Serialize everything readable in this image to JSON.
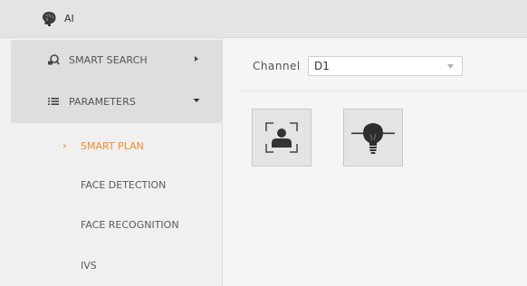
{
  "header": {
    "title": "AI",
    "icon": "brain-icon"
  },
  "sidebar": {
    "groups": [
      {
        "label": "SMART SEARCH",
        "icon": "smart-search-icon",
        "expanded": false
      },
      {
        "label": "PARAMETERS",
        "icon": "list-icon",
        "expanded": true
      }
    ],
    "sub_items": [
      {
        "label": "SMART PLAN",
        "active": true
      },
      {
        "label": "FACE DETECTION",
        "active": false
      },
      {
        "label": "FACE RECOGNITION",
        "active": false
      },
      {
        "label": "IVS",
        "active": false
      }
    ],
    "active_caret": "›"
  },
  "main": {
    "channel_label": "Channel",
    "channel_value": "D1",
    "plan_buttons": [
      {
        "icon": "face-recognition-icon"
      },
      {
        "icon": "lightbulb-icon"
      }
    ]
  },
  "colors": {
    "accent": "#f28c28"
  }
}
